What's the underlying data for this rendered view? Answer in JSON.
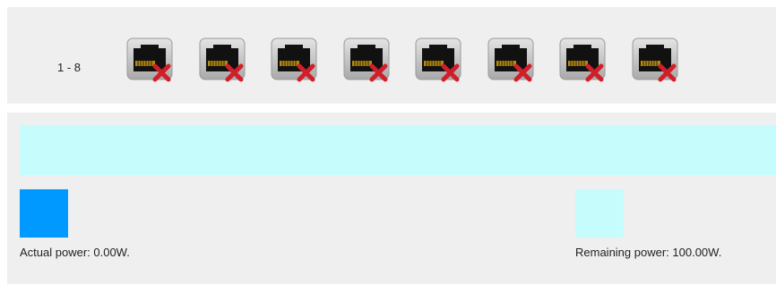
{
  "ports": {
    "range_label": "1 - 8",
    "items": [
      {
        "status": "disconnected"
      },
      {
        "status": "disconnected"
      },
      {
        "status": "disconnected"
      },
      {
        "status": "disconnected"
      },
      {
        "status": "disconnected"
      },
      {
        "status": "disconnected"
      },
      {
        "status": "disconnected"
      },
      {
        "status": "disconnected"
      }
    ],
    "icon": "ethernet-port-disconnected-icon"
  },
  "power": {
    "actual_text": "Actual power: 0.00W.",
    "remaining_text": "Remaining power: 100.00W.",
    "actual_fraction": 0.0,
    "colors": {
      "actual": "#0099ff",
      "remaining": "#c6fcfc",
      "panel": "#efefef"
    }
  }
}
